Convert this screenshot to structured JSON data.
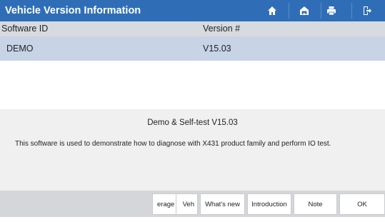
{
  "header": {
    "title": "Vehicle Version Information",
    "icons": [
      "home-icon",
      "vehicle-icon",
      "print-icon",
      "exit-icon"
    ],
    "accent_color": "#2f6eb7"
  },
  "table": {
    "columns": [
      "Software ID",
      "Version #"
    ],
    "rows": [
      {
        "software_id": "DEMO",
        "version": "V15.03"
      }
    ],
    "selected_row_color": "#c6d4e6"
  },
  "description": {
    "title": "Demo & Self-test V15.03",
    "text": "This software is used to demonstrate how to diagnose with X431 product family and perform IO test."
  },
  "buttons": {
    "coverage": "erage",
    "vehicle": "Veh",
    "whats_new": "What's new",
    "introduction": "Introduction",
    "note": "Note",
    "ok": "OK"
  }
}
